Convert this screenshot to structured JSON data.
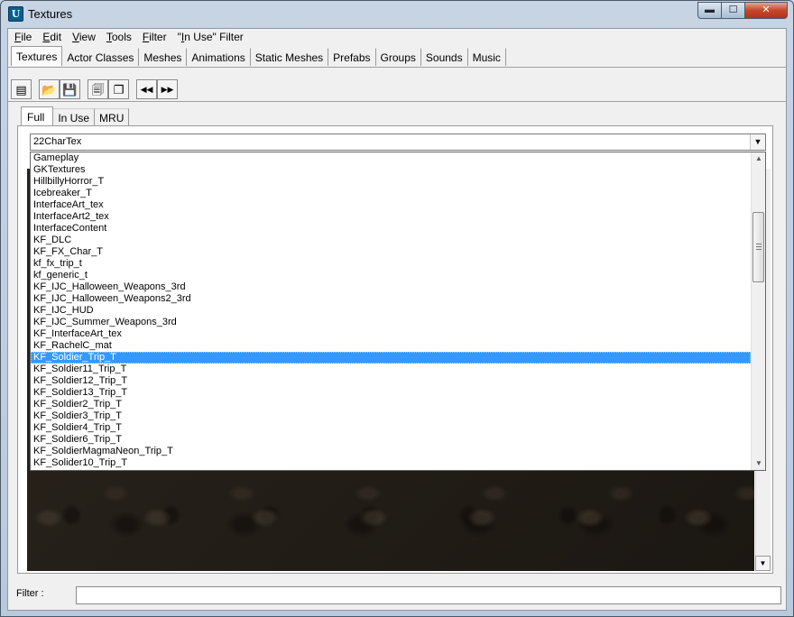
{
  "window": {
    "title": "Textures",
    "app_icon_glyph": "U",
    "controls": {
      "minimize": "▬",
      "maximize": "☐",
      "close": "✕"
    }
  },
  "menubar": {
    "items": [
      {
        "label": "File",
        "mnemonic": "F",
        "rest": "ile"
      },
      {
        "label": "Edit",
        "mnemonic": "E",
        "rest": "dit"
      },
      {
        "label": "View",
        "mnemonic": "V",
        "rest": "iew"
      },
      {
        "label": "Tools",
        "mnemonic": "T",
        "rest": "ools"
      },
      {
        "label": "Filter",
        "mnemonic": "F",
        "rest": "ilter"
      },
      {
        "label": "\"In Use\" Filter",
        "pre": "\"",
        "mnemonic": "I",
        "rest": "n Use\" Filter"
      }
    ]
  },
  "tabs": {
    "active": "Textures",
    "items": [
      "Textures",
      "Actor Classes",
      "Meshes",
      "Animations",
      "Static Meshes",
      "Prefabs",
      "Groups",
      "Sounds",
      "Music"
    ]
  },
  "toolbar": {
    "icons": [
      "browser-icon",
      "open-folder-icon",
      "save-disk-icon",
      "properties-icon",
      "copy-icon",
      "rewind-icon",
      "fast-forward-icon"
    ],
    "glyphs": [
      "▤",
      "📂",
      "💾",
      "🗐",
      "❐",
      "◀◀",
      "▶▶"
    ]
  },
  "subtabs": {
    "active": "Full",
    "items": [
      "Full",
      "In Use",
      "MRU"
    ]
  },
  "package_combo": {
    "value": "22CharTex",
    "arrow": "▼"
  },
  "package_list": {
    "selected": "KF_Soldier_Trip_T",
    "items": [
      "Gameplay",
      "GKTextures",
      "HillbillyHorror_T",
      "Icebreaker_T",
      "InterfaceArt_tex",
      "InterfaceArt2_tex",
      "InterfaceContent",
      "KF_DLC",
      "KF_FX_Char_T",
      "kf_fx_trip_t",
      "kf_generic_t",
      "KF_IJC_Halloween_Weapons_3rd",
      "KF_IJC_Halloween_Weapons2_3rd",
      "KF_IJC_HUD",
      "KF_IJC_Summer_Weapons_3rd",
      "KF_InterfaceArt_tex",
      "KF_RachelC_mat",
      "KF_Soldier_Trip_T",
      "KF_Soldier11_Trip_T",
      "KF_Soldier12_Trip_T",
      "KF_Soldier13_Trip_T",
      "KF_Soldier2_Trip_T",
      "KF_Soldier3_Trip_T",
      "KF_Soldier4_Trip_T",
      "KF_Soldier6_Trip_T",
      "KF_SoldierMagmaNeon_Trip_T",
      "KF_Solider10_Trip_T"
    ],
    "scroll_up": "▲",
    "scroll_down": "▼"
  },
  "filter": {
    "label": "Filter :",
    "value": "",
    "placeholder": ""
  }
}
